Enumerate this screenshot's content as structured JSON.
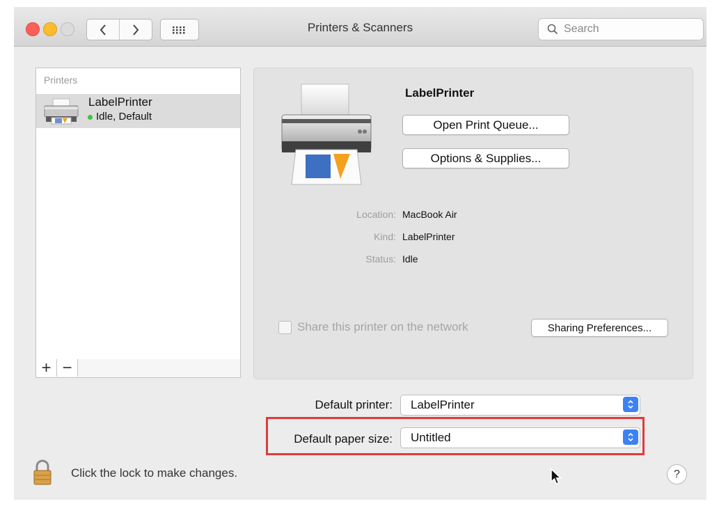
{
  "window": {
    "title": "Printers & Scanners"
  },
  "search": {
    "placeholder": "Search"
  },
  "printers_list": {
    "header": "Printers",
    "items": [
      {
        "name": "LabelPrinter",
        "status": "Idle, Default"
      }
    ],
    "add_label": "+",
    "remove_label": "−"
  },
  "detail": {
    "name": "LabelPrinter",
    "open_queue_label": "Open Print Queue...",
    "options_label": "Options & Supplies...",
    "info": [
      {
        "label": "Location:",
        "value": "MacBook Air"
      },
      {
        "label": "Kind:",
        "value": "LabelPrinter"
      },
      {
        "label": "Status:",
        "value": "Idle"
      }
    ],
    "share_label": "Share this printer on the network",
    "share_checked": false,
    "sharing_prefs_label": "Sharing Preferences..."
  },
  "defaults": {
    "printer_label": "Default printer:",
    "printer_value": "LabelPrinter",
    "paper_label": "Default paper size:",
    "paper_value": "Untitled"
  },
  "lock": {
    "label": "Click the lock to make changes."
  },
  "help_label": "?",
  "colors": {
    "highlight": "#e23a3a",
    "accent": "#3b82f7",
    "status_green": "#3fc43f"
  },
  "icons": [
    "close-button",
    "minimize-button",
    "zoom-button",
    "chevron-left-icon",
    "chevron-right-icon",
    "grid-icon",
    "search-icon",
    "printer-icon",
    "lock-icon",
    "cursor-icon"
  ]
}
